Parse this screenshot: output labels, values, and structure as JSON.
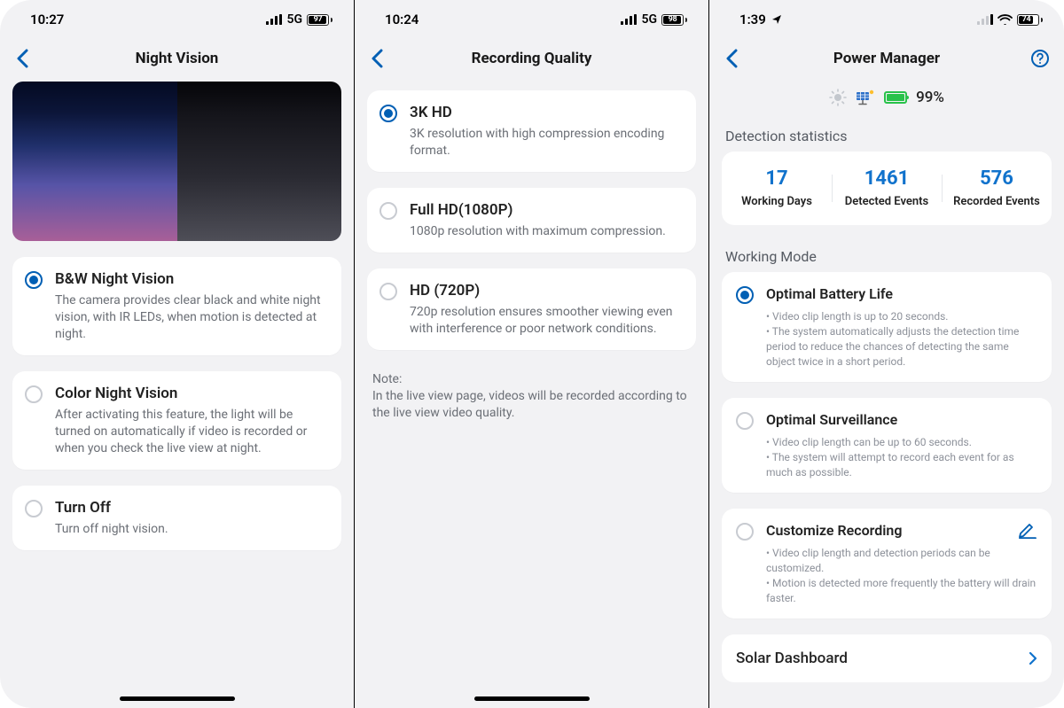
{
  "screens": {
    "nightVision": {
      "status": {
        "time": "10:27",
        "network": "5G",
        "battery": "97"
      },
      "title": "Night Vision",
      "options": [
        {
          "title": "B&W Night Vision",
          "desc": "The camera provides clear black and white night vision, with IR LEDs, when motion is detected at night.",
          "selected": true
        },
        {
          "title": "Color Night Vision",
          "desc": "After activating this feature, the light will be turned on automatically if video is recorded or when you check the live view at night.",
          "selected": false
        },
        {
          "title": "Turn Off",
          "desc": "Turn off night vision.",
          "selected": false
        }
      ]
    },
    "recordingQuality": {
      "status": {
        "time": "10:24",
        "network": "5G",
        "battery": "98"
      },
      "title": "Recording Quality",
      "options": [
        {
          "title": "3K HD",
          "desc": "3K resolution with high compression encoding format.",
          "selected": true
        },
        {
          "title": "Full HD(1080P)",
          "desc": "1080p resolution with maximum compression.",
          "selected": false
        },
        {
          "title": "HD (720P)",
          "desc": "720p resolution ensures smoother viewing even with interference or poor network conditions.",
          "selected": false
        }
      ],
      "note_label": "Note:",
      "note": "In the live view page, videos will be recorded according to the live view video quality."
    },
    "powerManager": {
      "status": {
        "time": "1:39",
        "network": "wifi",
        "battery": "74"
      },
      "title": "Power Manager",
      "battery_pct": "99%",
      "stats_label": "Detection statistics",
      "stats": [
        {
          "num": "17",
          "label": "Working Days"
        },
        {
          "num": "1461",
          "label": "Detected Events"
        },
        {
          "num": "576",
          "label": "Recorded Events"
        }
      ],
      "mode_label": "Working Mode",
      "modes": [
        {
          "title": "Optimal Battery Life",
          "desc": "• Video clip length is up to 20 seconds.\n• The system automatically adjusts the detection time period to reduce the chances of detecting the same object twice in a short period.",
          "selected": true
        },
        {
          "title": "Optimal Surveillance",
          "desc": "• Video clip length can be up to 60 seconds.\n• The system will attempt to record each event for as much as possible.",
          "selected": false
        },
        {
          "title": "Customize Recording",
          "desc": "• Video clip length and detection periods can be customized.\n• Motion is detected more frequently the battery will drain faster.",
          "selected": false,
          "edit": true
        }
      ],
      "solar_link": "Solar Dashboard"
    }
  }
}
